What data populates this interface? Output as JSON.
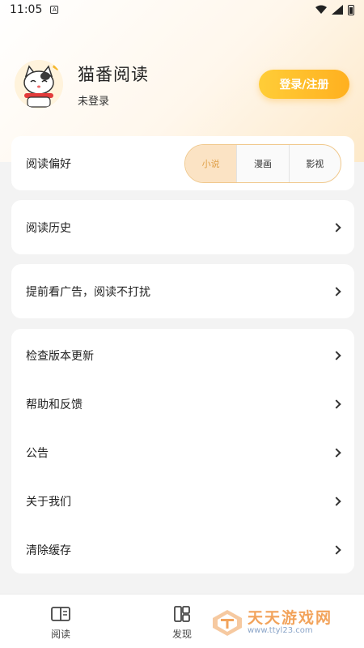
{
  "status_bar": {
    "time": "11:05",
    "sim_label": "A"
  },
  "profile": {
    "app_name": "猫番阅读",
    "login_state": "未登录",
    "login_button": "登录/注册"
  },
  "reading_pref": {
    "label": "阅读偏好",
    "options": [
      "小说",
      "漫画",
      "影视"
    ],
    "selected": "小说"
  },
  "menu_history": {
    "label": "阅读历史"
  },
  "menu_ads": {
    "label": "提前看广告，阅读不打扰"
  },
  "menu_list": [
    {
      "label": "检查版本更新"
    },
    {
      "label": "帮助和反馈"
    },
    {
      "label": "公告"
    },
    {
      "label": "关于我们"
    },
    {
      "label": "清除缓存"
    }
  ],
  "bottom_nav": [
    {
      "label": "阅读",
      "icon": "book-icon"
    },
    {
      "label": "发现",
      "icon": "discover-grid-icon"
    }
  ],
  "watermark": {
    "title": "天天游戏网",
    "url": "www.ttyl23.com"
  },
  "colors": {
    "accent": "#ffbf2c",
    "selected_bg": "#fbe3c4",
    "selected_text": "#e0a14a"
  }
}
